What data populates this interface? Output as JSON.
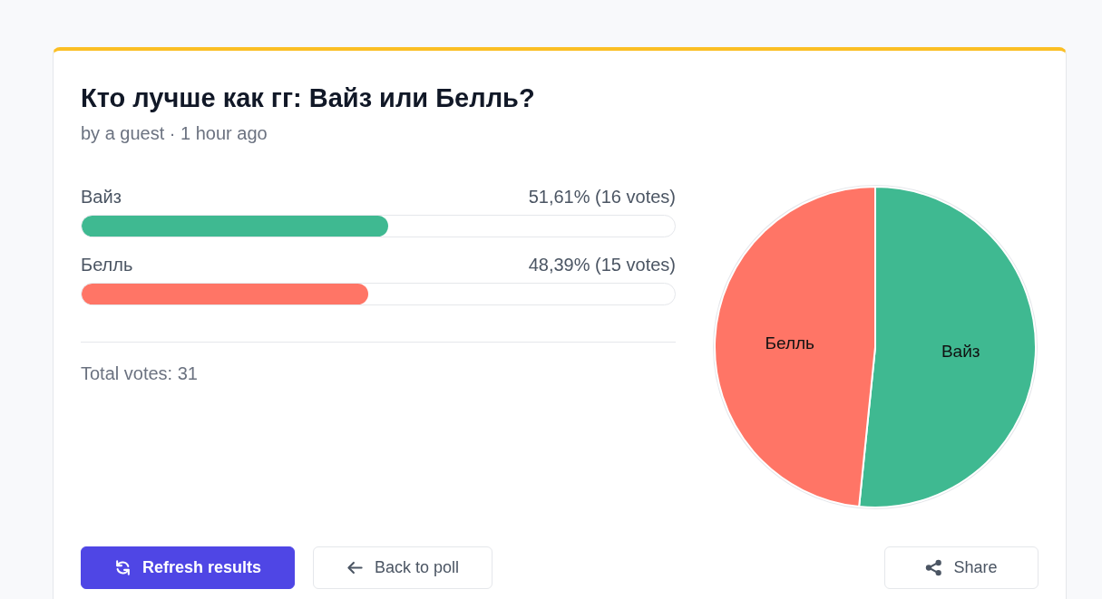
{
  "poll": {
    "title": "Кто лучше как гг: Вайз или Белль?",
    "meta": "by a guest · 1 hour ago"
  },
  "options": [
    {
      "label": "Вайз",
      "reading": "51,61% (16 votes)",
      "level": 0.5161,
      "color": "#3fb991"
    },
    {
      "label": "Белль",
      "reading": "48,39% (15 votes)",
      "level": 0.4839,
      "color": "#ff7566"
    }
  ],
  "total": "Total votes: 31",
  "chart": {
    "chart_data": {
      "type": "pie",
      "categories": [
        "Вайз",
        "Белль"
      ],
      "values": [
        51.61,
        48.39
      ]
    }
  },
  "buttons": [
    {
      "label": "Refresh results",
      "kind": "primary"
    },
    {
      "label": "Back to poll",
      "kind": "secondary"
    },
    {
      "label": "Share",
      "kind": "secondary"
    }
  ]
}
